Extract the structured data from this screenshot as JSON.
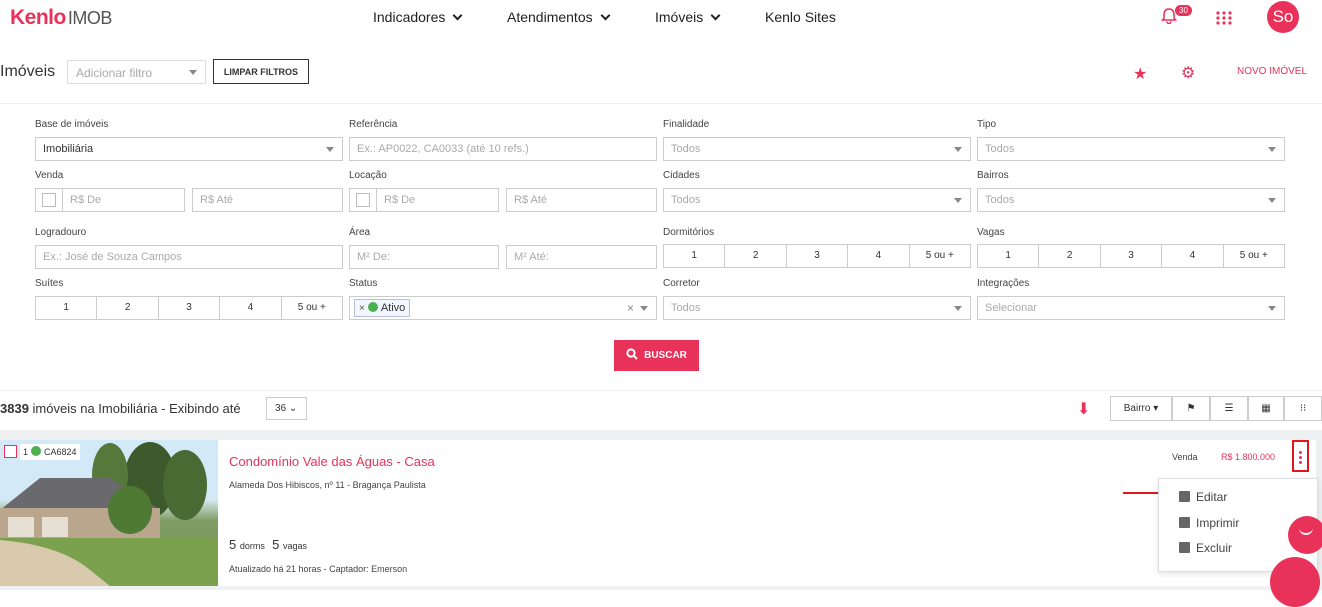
{
  "brand": {
    "name": "Kenlo",
    "product": "IMOB"
  },
  "nav": {
    "items": [
      {
        "label": "Indicadores"
      },
      {
        "label": "Atendimentos"
      },
      {
        "label": "Imóveis"
      },
      {
        "label": "Kenlo Sites"
      }
    ],
    "notifications": "30",
    "avatar": "So"
  },
  "header": {
    "title": "Imóveis",
    "filter_placeholder": "Adicionar filtro",
    "clear_label": "LIMPAR FILTROS",
    "new_label": "NOVO IMÓVEL"
  },
  "form": {
    "base": {
      "label": "Base de imóveis",
      "value": "Imobiliária"
    },
    "referencia": {
      "label": "Referência",
      "placeholder": "Ex.: AP0022, CA0033 (até 10 refs.)"
    },
    "finalidade": {
      "label": "Finalidade",
      "value": "Todos"
    },
    "tipo": {
      "label": "Tipo",
      "value": "Todos"
    },
    "venda": {
      "label": "Venda",
      "de": "R$ De",
      "ate": "R$ Até"
    },
    "locacao": {
      "label": "Locação",
      "de": "R$ De",
      "ate": "R$ Até"
    },
    "cidades": {
      "label": "Cidades",
      "value": "Todos"
    },
    "bairros": {
      "label": "Bairros",
      "value": "Todos"
    },
    "logradouro": {
      "label": "Logradouro",
      "placeholder": "Ex.: José de Souza Campos"
    },
    "area": {
      "label": "Área",
      "de": "M² De:",
      "ate": "M² Até:"
    },
    "dormitorios": {
      "label": "Dormitórios",
      "options": [
        "1",
        "2",
        "3",
        "4",
        "5 ou +"
      ]
    },
    "vagas": {
      "label": "Vagas",
      "options": [
        "1",
        "2",
        "3",
        "4",
        "5 ou +"
      ]
    },
    "suites": {
      "label": "Suítes",
      "options": [
        "1",
        "2",
        "3",
        "4",
        "5 ou +"
      ]
    },
    "status": {
      "label": "Status",
      "tag_remove": "×",
      "tag": "Ativo",
      "clear": "×"
    },
    "corretor": {
      "label": "Corretor",
      "value": "Todos"
    },
    "integracoes": {
      "label": "Integrações",
      "value": "Selecionar"
    },
    "search_label": "BUSCAR"
  },
  "results": {
    "count": "3839",
    "text": " imóveis na Imobiliária - Exibindo até",
    "per_page": "36",
    "sort": "Bairro"
  },
  "listing": {
    "index": "1",
    "code": "CA6824",
    "title": "Condomínio Vale das Águas - Casa",
    "address": "Alameda Dos Hibiscos, nº 11 - Bragança Paulista",
    "dorms": "5",
    "dorms_label": "dorms",
    "vagas": "5",
    "vagas_label": "vagas",
    "updated": "Atualizado há 21 horas - Captador: Emerson",
    "tipo": "Venda",
    "price": "R$ 1.800.000"
  },
  "menu": {
    "items": [
      {
        "label": "Editar"
      },
      {
        "label": "Imprimir"
      },
      {
        "label": "Excluir"
      }
    ]
  },
  "colors": {
    "accent": "#e8325a",
    "active": "#4cb050"
  }
}
